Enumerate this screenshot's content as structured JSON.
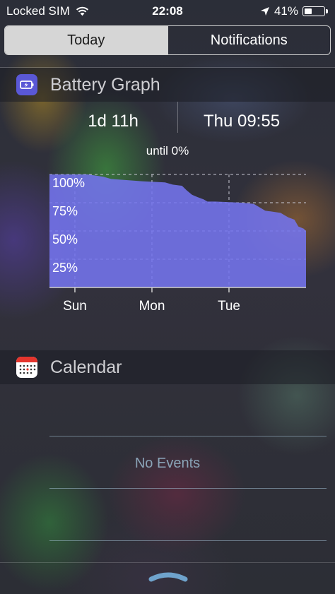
{
  "status_bar": {
    "carrier": "Locked SIM",
    "time": "22:08",
    "battery_percent": "41%",
    "battery_level": 0.41,
    "icons": [
      "wifi-icon",
      "location-arrow-icon",
      "battery-icon"
    ]
  },
  "tabs": [
    {
      "label": "Today",
      "selected": true
    },
    {
      "label": "Notifications",
      "selected": false
    }
  ],
  "battery_widget": {
    "title": "Battery Graph",
    "icon": "battery-graph-app-icon",
    "remaining": "1d 11h",
    "empty_at": "Thu 09:55",
    "until_label": "until 0%"
  },
  "calendar_widget": {
    "title": "Calendar",
    "icon": "calendar-app-icon",
    "empty_text": "No Events"
  },
  "colors": {
    "battery_fill": "#7474ee",
    "battery_icon_bg": "#5a58d6",
    "selected_tab_bg": "#d6d6d6"
  },
  "chart_data": {
    "type": "area",
    "title": "",
    "xlabel": "",
    "ylabel": "",
    "y_tick_labels": [
      "100%",
      "75%",
      "50%",
      "25%"
    ],
    "y_ticks": [
      100,
      75,
      50,
      25
    ],
    "ylim": [
      0,
      100
    ],
    "x_tick_labels": [
      "Sun",
      "Mon",
      "Tue"
    ],
    "x_ticks": [
      0.33,
      1.33,
      2.33
    ],
    "xlim": [
      0,
      3.33
    ],
    "grid": true,
    "series": [
      {
        "values": [
          [
            0.0,
            100
          ],
          [
            0.15,
            100
          ],
          [
            0.5,
            100
          ],
          [
            0.7,
            98
          ],
          [
            0.8,
            96
          ],
          [
            1.0,
            95
          ],
          [
            1.2,
            94
          ],
          [
            1.5,
            93
          ],
          [
            1.6,
            91
          ],
          [
            1.72,
            90
          ],
          [
            1.78,
            86
          ],
          [
            1.85,
            82
          ],
          [
            1.92,
            80
          ],
          [
            2.0,
            78
          ],
          [
            2.05,
            76
          ],
          [
            2.15,
            76
          ],
          [
            2.5,
            75
          ],
          [
            2.65,
            74
          ],
          [
            2.75,
            70
          ],
          [
            2.8,
            68
          ],
          [
            2.9,
            67
          ],
          [
            3.0,
            66
          ],
          [
            3.05,
            64
          ],
          [
            3.1,
            62
          ],
          [
            3.18,
            60
          ],
          [
            3.23,
            54
          ],
          [
            3.3,
            52
          ],
          [
            3.33,
            50
          ]
        ]
      }
    ]
  }
}
